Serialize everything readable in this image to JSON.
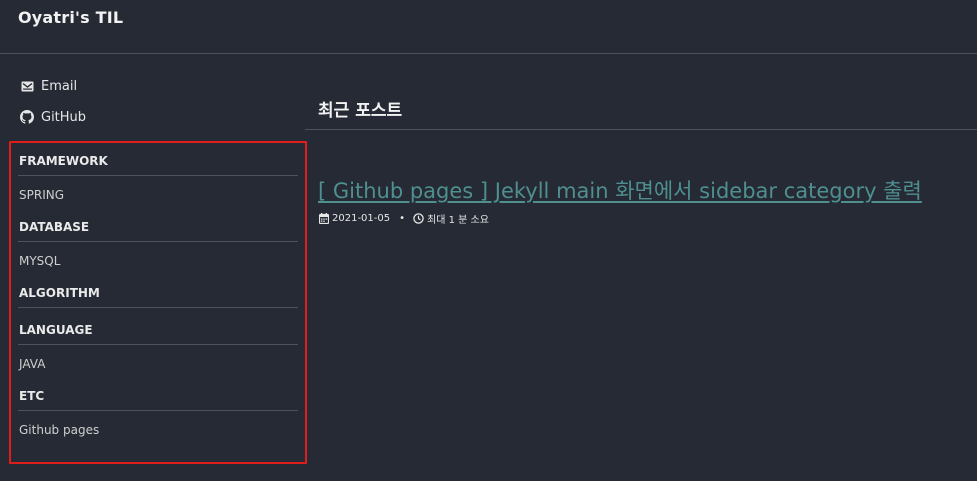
{
  "masthead": {
    "title": "Oyatri's TIL"
  },
  "author": {
    "links": [
      {
        "label": "Email",
        "icon": "envelope-icon"
      },
      {
        "label": "GitHub",
        "icon": "github-icon"
      }
    ]
  },
  "sidebar": {
    "highlight_color": "#e01d1d",
    "categories": [
      {
        "title": "FRAMEWORK",
        "items": [
          "SPRING"
        ]
      },
      {
        "title": "DATABASE",
        "items": [
          "MYSQL"
        ]
      },
      {
        "title": "ALGORITHM",
        "items": []
      },
      {
        "title": "LANGUAGE",
        "items": [
          "JAVA"
        ]
      },
      {
        "title": "ETC",
        "items": [
          "Github pages"
        ]
      }
    ]
  },
  "main": {
    "page_title": "최근 포스트",
    "posts": [
      {
        "title": "[ Github pages ] Jekyll main 화면에서 sidebar category 출력",
        "date": "2021-01-05",
        "read_time": "최대 1 분 소요"
      }
    ],
    "link_color": "#4f8f90"
  }
}
